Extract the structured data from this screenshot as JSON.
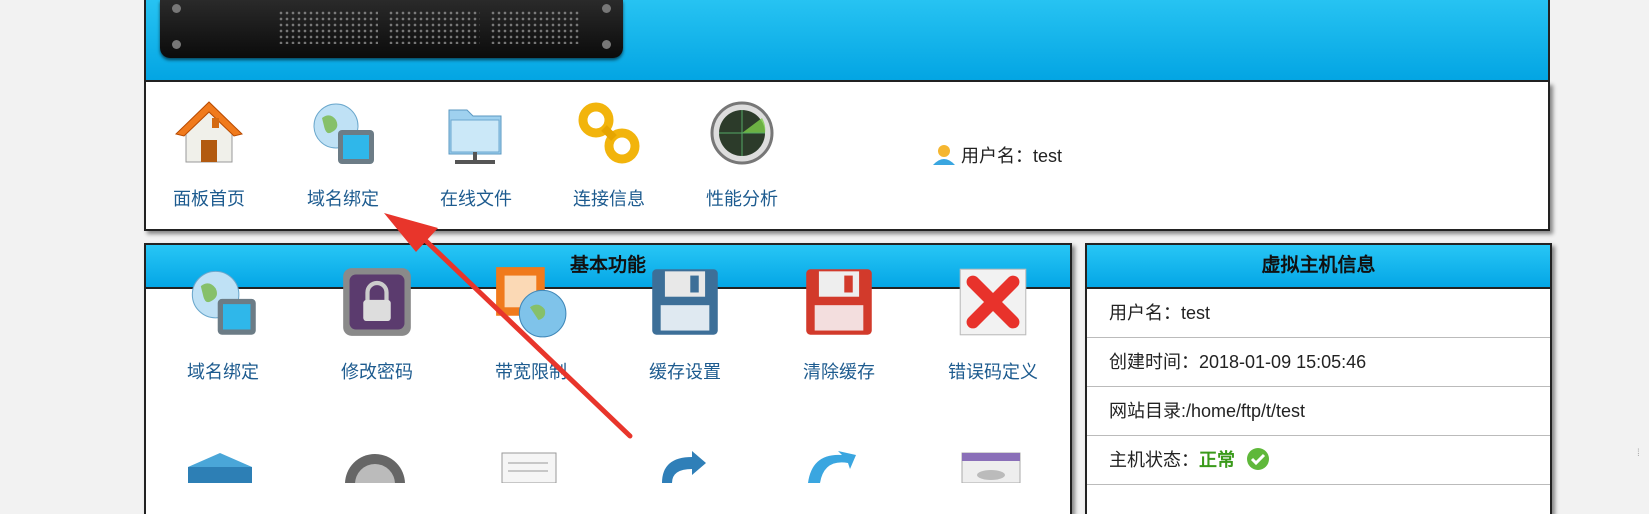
{
  "nav": {
    "items": [
      {
        "label": "面板首页",
        "icon": "home-icon"
      },
      {
        "label": "域名绑定",
        "icon": "globe-monitor-icon"
      },
      {
        "label": "在线文件",
        "icon": "network-folder-icon"
      },
      {
        "label": "连接信息",
        "icon": "chain-link-icon"
      },
      {
        "label": "性能分析",
        "icon": "radar-icon"
      }
    ],
    "user_label": "用户名：test"
  },
  "basic": {
    "title": "基本功能",
    "items": [
      {
        "label": "域名绑定",
        "icon": "globe-monitor-icon"
      },
      {
        "label": "修改密码",
        "icon": "lock-icon"
      },
      {
        "label": "带宽限制",
        "icon": "bandwidth-globe-icon"
      },
      {
        "label": "缓存设置",
        "icon": "floppy-blue-icon"
      },
      {
        "label": "清除缓存",
        "icon": "floppy-red-icon"
      },
      {
        "label": "错误码定义",
        "icon": "red-x-icon"
      }
    ]
  },
  "host": {
    "title": "虚拟主机信息",
    "username": "用户名：test",
    "created": "创建时间：2018-01-09 15:05:46",
    "webroot": "网站目录:/home/ftp/t/test",
    "status_label": "主机状态：",
    "status_value": "正常"
  },
  "colors": {
    "header": "#03a5e3",
    "link": "#1d5b8f",
    "status_ok": "#3a9a1a",
    "arrow": "#e8352b"
  }
}
